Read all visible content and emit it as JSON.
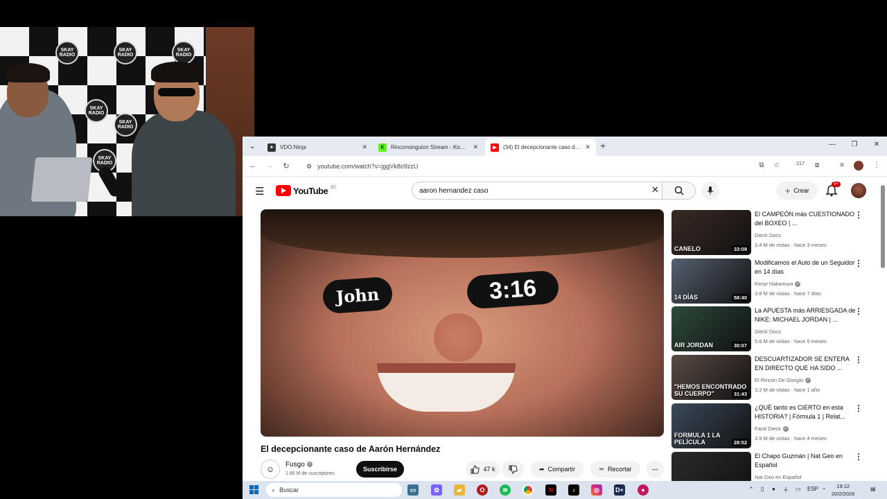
{
  "webcam": {
    "backdrop_text": "SKAY RADIO"
  },
  "browser": {
    "tabs": [
      {
        "label": "VDO.Ninja",
        "icon": "ninja-icon"
      },
      {
        "label": "Rinconsinguion Stream - Kick D",
        "icon": "kick-icon"
      },
      {
        "label": "(34) El decepcionante caso de A",
        "icon": "youtube-icon"
      }
    ],
    "url": "youtube.com/watch?v=jggVk8o9zzU",
    "extension_badge": "217"
  },
  "youtube": {
    "country": "EC",
    "logo_text": "YouTube",
    "search_query": "aaron hernandez caso",
    "create_label": "Crear",
    "notif_count": "9+",
    "video": {
      "eyeblack_left": "John",
      "eyeblack_right": "3:16",
      "title": "El decepcionante caso de Aarón Hernández",
      "channel": "Fusgo",
      "subscribers": "1.66 M de suscriptores",
      "subscribe_label": "Suscribirse",
      "likes": "47 k",
      "share_label": "Compartir",
      "clip_label": "Recortar"
    },
    "recommendations": [
      {
        "title": "El CAMPEÓN más CUESTIONADO del BOXEO | ...",
        "channel": "Dieck Docs",
        "meta": "3.4 M de vistas · hace 3 meses",
        "duration": "33:09",
        "thumb_text": "CANELO",
        "verified": false,
        "color": "#3a2a24"
      },
      {
        "title": "Modificamos el Auto de un Seguidor en 14 días",
        "channel": "Kenyi Nakamura",
        "meta": "3.8 M de vistas · hace 7 días",
        "duration": "58:40",
        "thumb_text": "14 DÍAS",
        "verified": true,
        "color": "#556070"
      },
      {
        "title": "La APUESTA más ARRIESGADA de NIKE: MICHAEL JORDAN | ...",
        "channel": "Dieck Docs",
        "meta": "5.6 M de vistas · hace 5 meses",
        "duration": "30:07",
        "thumb_text": "AIR JORDAN",
        "verified": false,
        "color": "#2c4a3a"
      },
      {
        "title": "DESCUARTIZADOR SE ENTERA EN DIRECTO QUE HA SIDO ...",
        "channel": "El Rincón De Giorgio",
        "meta": "3.2 M de vistas · hace 1 año",
        "duration": "31:43",
        "thumb_text": "\"HEMOS ENCONTRADO SU CUERPO\"",
        "verified": true,
        "color": "#5a4a44"
      },
      {
        "title": "¿QUÉ tanto es CIERTO en esta HISTORIA? | Fórmula 1 | Relat...",
        "channel": "Farid Dieck",
        "meta": "3.9 M de vistas · hace 4 meses",
        "duration": "28:52",
        "thumb_text": "FORMULA 1 LA PELÍCULA",
        "verified": true,
        "color": "#3b4a5a"
      },
      {
        "title": "El Chapo Guzmán | Nat Geo en Español",
        "channel": "Nat Geo en Español",
        "meta": "",
        "duration": "",
        "thumb_text": "",
        "verified": false,
        "color": "#2b2b2b"
      }
    ]
  },
  "taskbar": {
    "search_placeholder": "Buscar",
    "language": "ESP",
    "time": "19:12",
    "date": "20/2/2026"
  }
}
